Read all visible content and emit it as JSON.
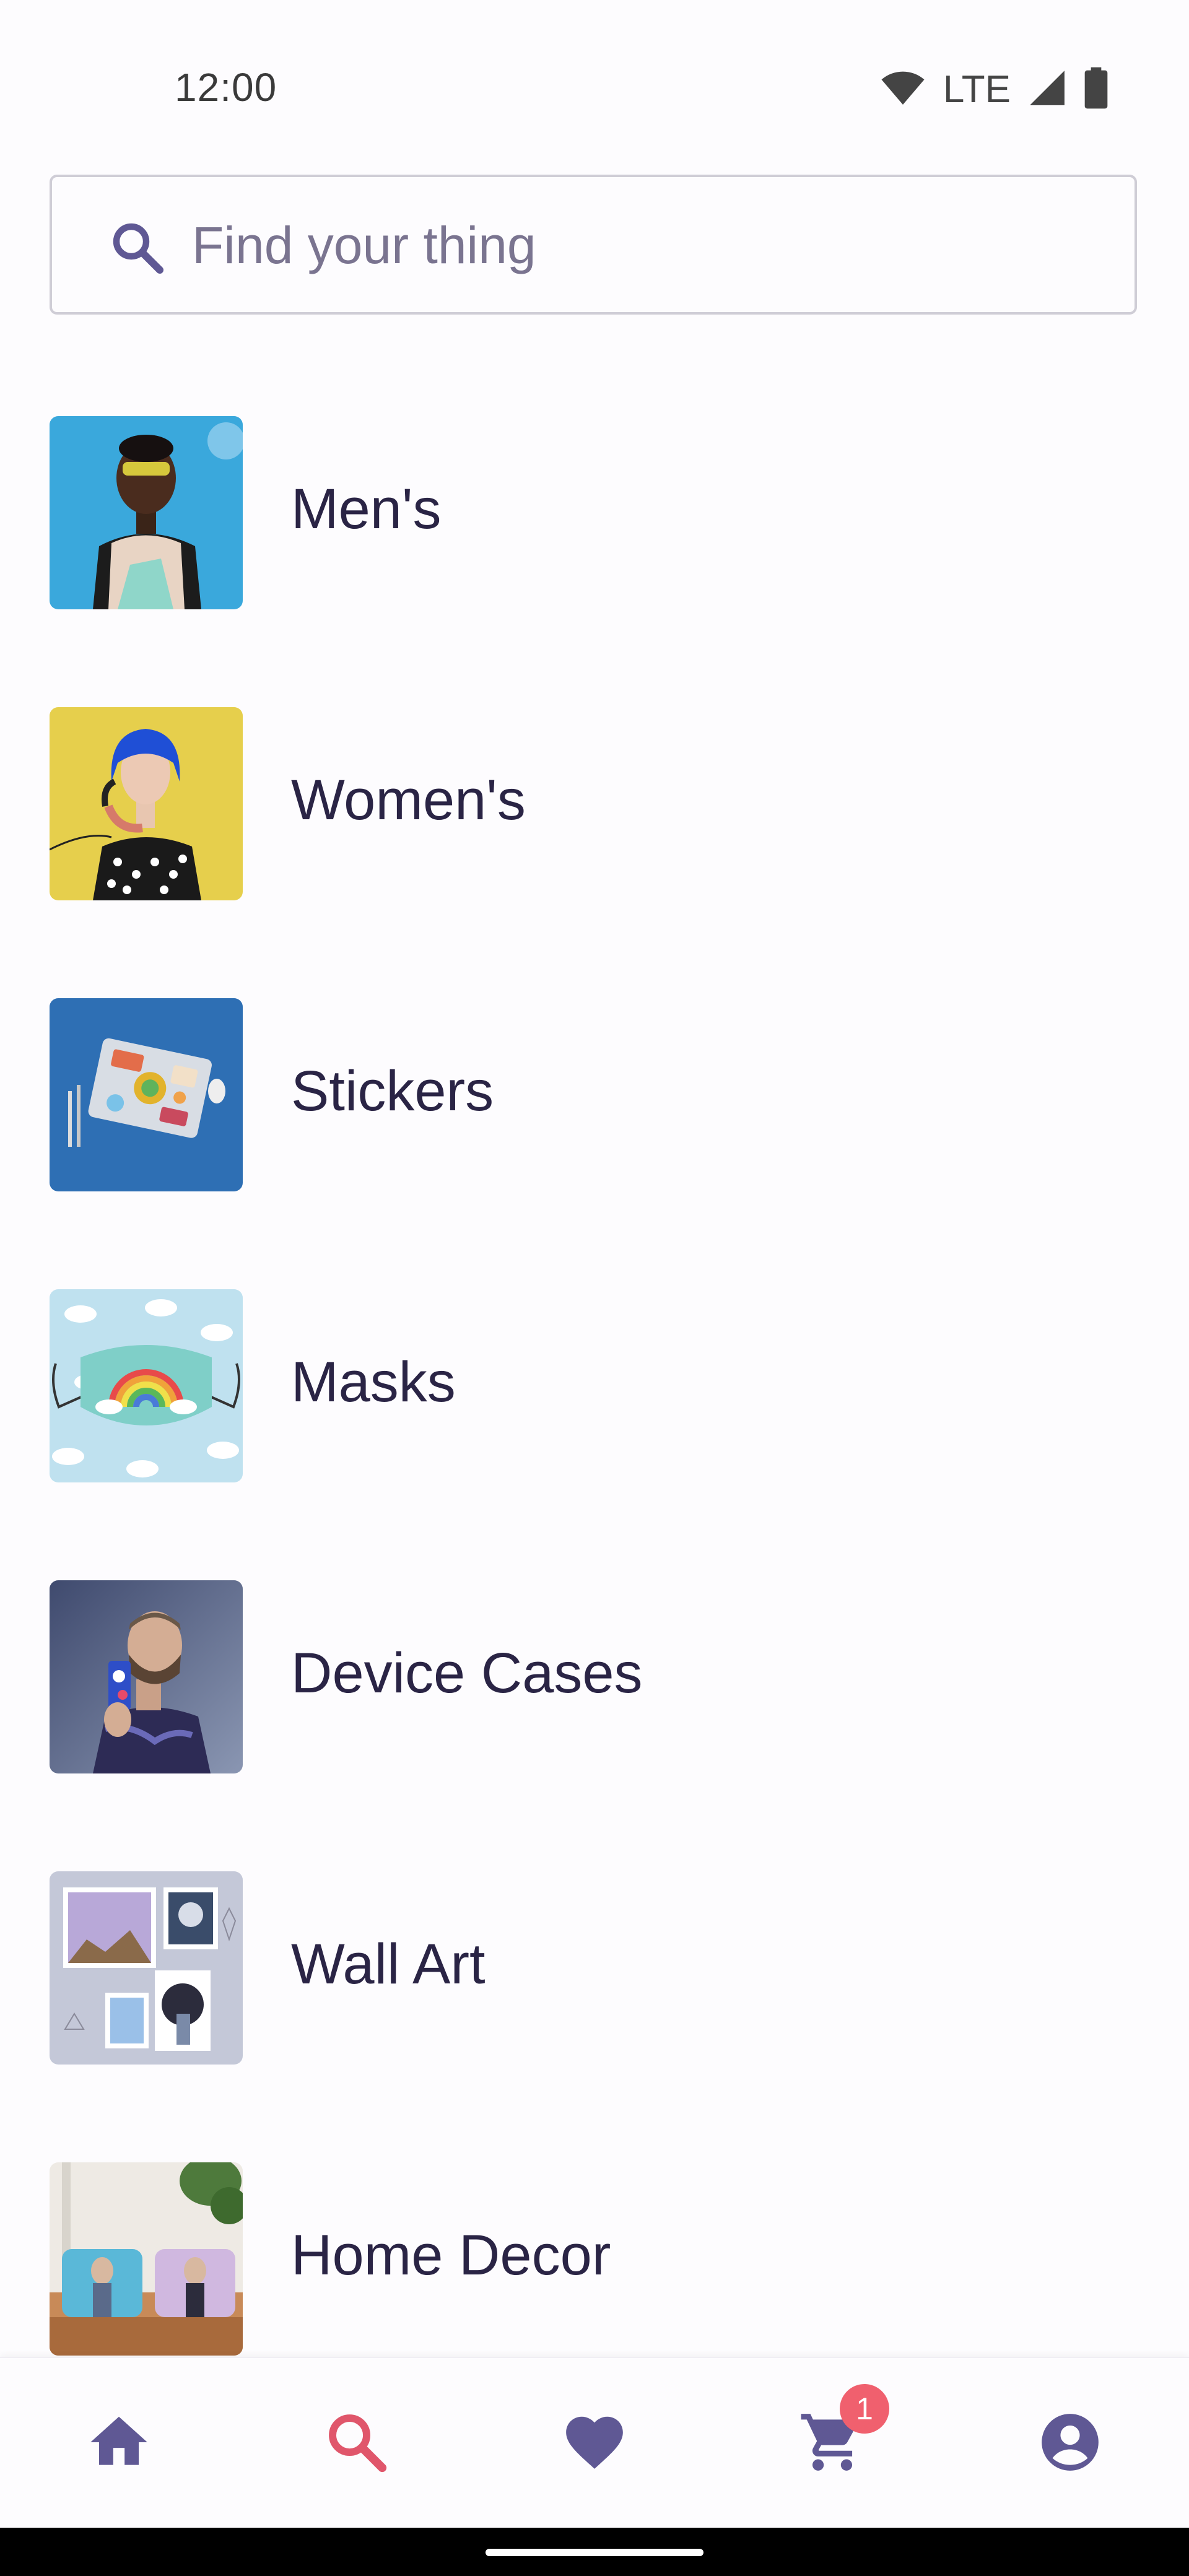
{
  "status_bar": {
    "time": "12:00",
    "network": "LTE",
    "icons": [
      "wifi-icon",
      "cell-signal-icon",
      "battery-icon"
    ]
  },
  "search": {
    "placeholder": "Find your thing",
    "value": ""
  },
  "categories": [
    {
      "label": "Men's",
      "thumb": "mens-thumbnail"
    },
    {
      "label": "Women's",
      "thumb": "womens-thumbnail"
    },
    {
      "label": "Stickers",
      "thumb": "stickers-thumbnail"
    },
    {
      "label": "Masks",
      "thumb": "masks-thumbnail"
    },
    {
      "label": "Device Cases",
      "thumb": "device-cases-thumbnail"
    },
    {
      "label": "Wall Art",
      "thumb": "wall-art-thumbnail"
    },
    {
      "label": "Home Decor",
      "thumb": "home-decor-thumbnail"
    }
  ],
  "bottom_nav": {
    "items": [
      {
        "name": "home",
        "icon": "home-icon",
        "active": false
      },
      {
        "name": "search",
        "icon": "search-icon",
        "active": true
      },
      {
        "name": "favorites",
        "icon": "heart-icon",
        "active": false
      },
      {
        "name": "cart",
        "icon": "cart-icon",
        "active": false
      },
      {
        "name": "account",
        "icon": "account-icon",
        "active": false
      }
    ],
    "cart_badge": "1"
  },
  "colors": {
    "text_primary": "#2a2445",
    "icon_default": "#5f5894",
    "icon_active": "#e0566b",
    "badge": "#f0606e",
    "background": "#fdfcfe"
  }
}
